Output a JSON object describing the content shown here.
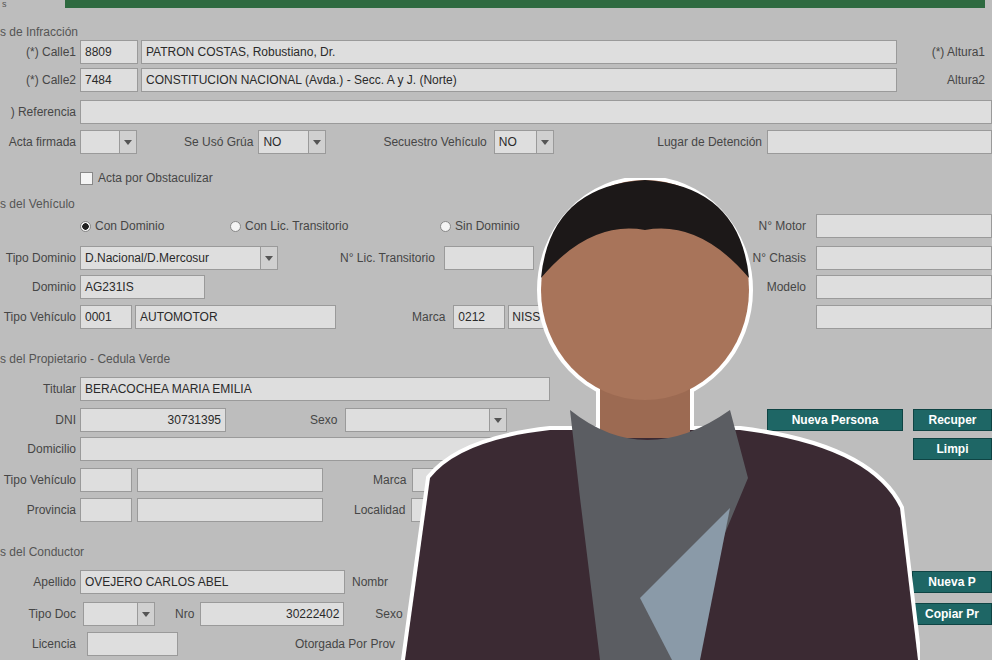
{
  "top_bar": {
    "label": "s"
  },
  "infraccion": {
    "title": "s de Infracción",
    "calles": [
      {
        "label": "(*) Calle1",
        "code": "8809",
        "value": "PATRON COSTAS, Robustiano, Dr.",
        "altura_label": "(*) Altura1"
      },
      {
        "label": "(*) Calle2",
        "code": "7484",
        "value": "CONSTITUCION NACIONAL (Avda.) - Secc. A y J. (Norte)",
        "altura_label": "Altura2"
      }
    ],
    "referencia": {
      "label": ") Referencia",
      "value": ""
    },
    "acta_firmada": {
      "label": "Acta firmada",
      "value": ""
    },
    "grua": {
      "label": "Se Usó Grúa",
      "value": "NO"
    },
    "secuestro": {
      "label": "Secuestro Vehículo",
      "value": "NO"
    },
    "lugar_detencion": {
      "label": "Lugar de Detención",
      "value": ""
    },
    "obstaculizar": {
      "label": "Acta por Obstaculizar",
      "checked": false
    }
  },
  "vehiculo": {
    "title": "s del Vehículo",
    "dominio_options": [
      {
        "label": "Con Dominio",
        "selected": true
      },
      {
        "label": "Con Lic. Transitorio",
        "selected": false
      },
      {
        "label": "Sin Dominio",
        "selected": false
      }
    ],
    "motor": {
      "label": "N° Motor",
      "value": ""
    },
    "tipo_dominio": {
      "label": "Tipo Dominio",
      "value": "D.Nacional/D.Mercosur"
    },
    "lic_transitorio": {
      "label": "N° Lic. Transitorio",
      "value": ""
    },
    "chasis": {
      "label": "N° Chasis",
      "value": ""
    },
    "dominio": {
      "label": "Dominio",
      "value": "AG231IS"
    },
    "modelo": {
      "label": "Modelo",
      "value": ""
    },
    "tipo": {
      "label": "Tipo Vehículo",
      "code": "0001",
      "value": "AUTOMOTOR"
    },
    "marca": {
      "label": "Marca",
      "code": "0212",
      "value": "NISS"
    },
    "extra": {
      "value": ""
    }
  },
  "propietario": {
    "title": "s del Propietario - Cedula Verde",
    "titular": {
      "label": "Titular",
      "value": "BERACOCHEA MARIA EMILIA"
    },
    "dni": {
      "label": "DNI",
      "value": "30731395"
    },
    "sexo": {
      "label": "Sexo",
      "value": ""
    },
    "domicilio": {
      "label": "Domicilio",
      "value": ""
    },
    "tipo": {
      "label": "Tipo Vehículo",
      "code": "",
      "value": ""
    },
    "marca": {
      "label": "Marca",
      "code": "",
      "value": ""
    },
    "provincia": {
      "label": "Provincia",
      "code": "",
      "value": ""
    },
    "localidad": {
      "label": "Localidad",
      "value": ""
    },
    "new_button": "Nueva Persona",
    "recover_button": "Recuper",
    "clear_button": "Limpi"
  },
  "conductor": {
    "title": "s del Conductor",
    "apellido": {
      "label": "Apellido",
      "value": "OVEJERO CARLOS ABEL"
    },
    "nombre_label": "Nombr",
    "tipo_doc": {
      "label": "Tipo Doc",
      "value": ""
    },
    "nro": {
      "label": "Nro",
      "value": "30222402"
    },
    "sexo_label": "Sexo",
    "licencia": {
      "label": "Licencia",
      "value": ""
    },
    "otorgada_label": "Otorgada Por Prov",
    "new_button": "Nueva P",
    "copy_button": "Copiar Pr"
  }
}
